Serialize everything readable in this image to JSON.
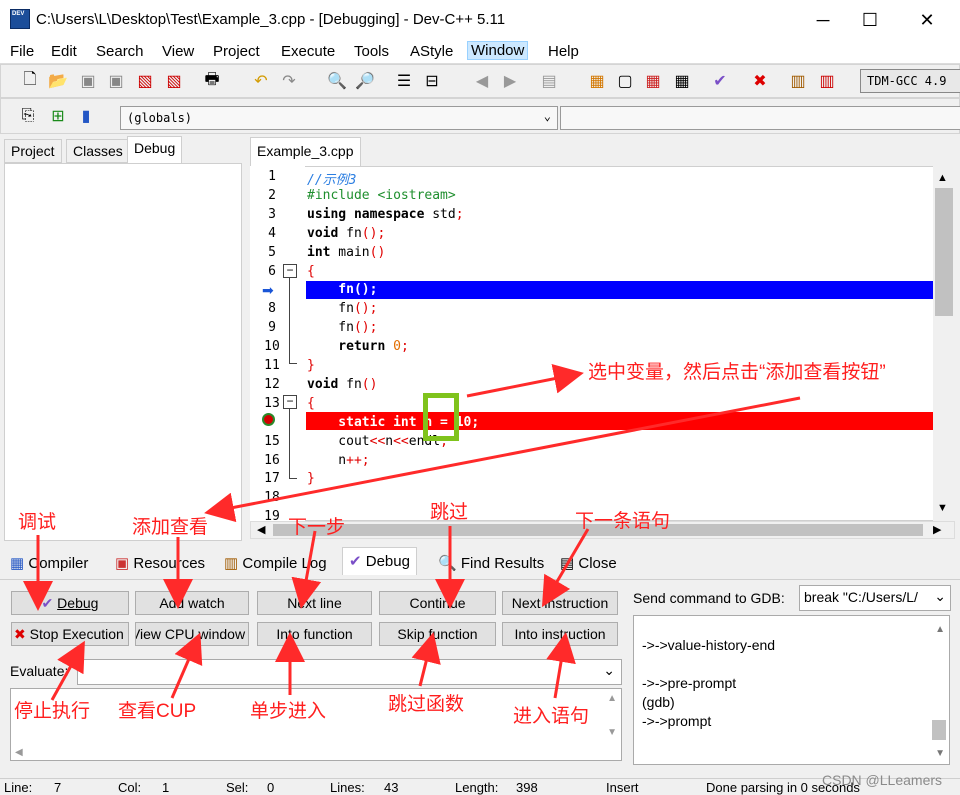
{
  "window": {
    "title": "C:\\Users\\L\\Desktop\\Test\\Example_3.cpp - [Debugging] - Dev-C++ 5.11"
  },
  "menu": [
    "File",
    "Edit",
    "Search",
    "View",
    "Project",
    "Execute",
    "Tools",
    "AStyle",
    "Window",
    "Help"
  ],
  "toolbar": {
    "compiler": "TDM-GCC 4.9",
    "scope": "(globals)"
  },
  "left_tabs": [
    "Project",
    "Classes",
    "Debug"
  ],
  "editor": {
    "tab": "Example_3.cpp",
    "lines": [
      "1",
      "2",
      "3",
      "4",
      "5",
      "6",
      "",
      "8",
      "9",
      "10",
      "11",
      "12",
      "13",
      "",
      "15",
      "16",
      "17",
      "18",
      "19"
    ],
    "code": [
      {
        "parts": [
          {
            "t": "//示例3",
            "c": "cm"
          }
        ]
      },
      {
        "parts": [
          {
            "t": "#include <iostream>",
            "c": "pp"
          }
        ]
      },
      {
        "parts": [
          {
            "t": "using namespace",
            "c": "kw"
          },
          {
            "t": " std"
          },
          {
            "t": ";",
            "c": "sym"
          }
        ]
      },
      {
        "parts": [
          {
            "t": "void",
            "c": "kw"
          },
          {
            "t": " fn"
          },
          {
            "t": "();",
            "c": "sym"
          }
        ]
      },
      {
        "parts": [
          {
            "t": "int",
            "c": "kw"
          },
          {
            "t": " main"
          },
          {
            "t": "()",
            "c": "sym"
          }
        ]
      },
      {
        "parts": [
          {
            "t": "{",
            "c": "sym"
          }
        ]
      },
      {
        "parts": [
          {
            "t": "    fn();",
            "c": "wh"
          }
        ]
      },
      {
        "parts": [
          {
            "t": "    fn"
          },
          {
            "t": "();",
            "c": "sym"
          }
        ]
      },
      {
        "parts": [
          {
            "t": "    fn"
          },
          {
            "t": "();",
            "c": "sym"
          }
        ]
      },
      {
        "parts": [
          {
            "t": "    return",
            "c": "kw"
          },
          {
            "t": " 0",
            "c": "num"
          },
          {
            "t": ";",
            "c": "sym"
          }
        ]
      },
      {
        "parts": [
          {
            "t": "}",
            "c": "sym"
          }
        ]
      },
      {
        "parts": [
          {
            "t": "void",
            "c": "kw"
          },
          {
            "t": " fn"
          },
          {
            "t": "()",
            "c": "sym"
          }
        ]
      },
      {
        "parts": [
          {
            "t": "{",
            "c": "sym"
          }
        ]
      },
      {
        "parts": [
          {
            "t": "    static int n = 10;",
            "c": "wh"
          }
        ]
      },
      {
        "parts": [
          {
            "t": "    cout"
          },
          {
            "t": "<<",
            "c": "sym"
          },
          {
            "t": "n"
          },
          {
            "t": "<<",
            "c": "sym"
          },
          {
            "t": "endl"
          },
          {
            "t": ";",
            "c": "sym"
          }
        ]
      },
      {
        "parts": [
          {
            "t": "    n"
          },
          {
            "t": "++;",
            "c": "sym"
          }
        ]
      },
      {
        "parts": [
          {
            "t": "}",
            "c": "sym"
          }
        ]
      },
      {
        "parts": [
          {
            "t": ""
          }
        ]
      },
      {
        "parts": [
          {
            "t": ""
          }
        ]
      }
    ]
  },
  "bottom_tabs": [
    "Compiler",
    "Resources",
    "Compile Log",
    "Debug",
    "Find Results",
    "Close"
  ],
  "debug": {
    "buttons": {
      "debug": "Debug",
      "add_watch": "Add watch",
      "next_line": "Next line",
      "continue": "Continue",
      "next_instruction": "Next instruction",
      "stop": "Stop Execution",
      "view_cpu": "View CPU window",
      "into_function": "Into function",
      "skip_function": "Skip function",
      "into_instruction": "Into instruction"
    },
    "evaluate_label": "Evaluate:",
    "gdb_label": "Send command to GDB:",
    "gdb_value": "break \"C:/Users/L/",
    "gdb_output": [
      "->->value-history-end",
      "",
      "->->pre-prompt",
      "(gdb)",
      "->->prompt"
    ]
  },
  "annotations": {
    "select_var": "选中变量，然后点击“添加查看按钮”",
    "debug": "调试",
    "add_watch": "添加查看",
    "next_step": "下一步",
    "skip": "跳过",
    "next_stmt": "下一条语句",
    "stop": "停止执行",
    "view_cpu": "查看CUP",
    "step_into": "单步进入",
    "skip_func": "跳过函数",
    "into_stmt": "进入语句"
  },
  "status": {
    "line_label": "Line:",
    "line": "7",
    "col_label": "Col:",
    "col": "1",
    "sel_label": "Sel:",
    "sel": "0",
    "lines_label": "Lines:",
    "lines": "43",
    "length_label": "Length:",
    "length": "398",
    "mode": "Insert",
    "msg": "Done parsing in 0 seconds"
  },
  "watermark": "CSDN @LLeamers"
}
